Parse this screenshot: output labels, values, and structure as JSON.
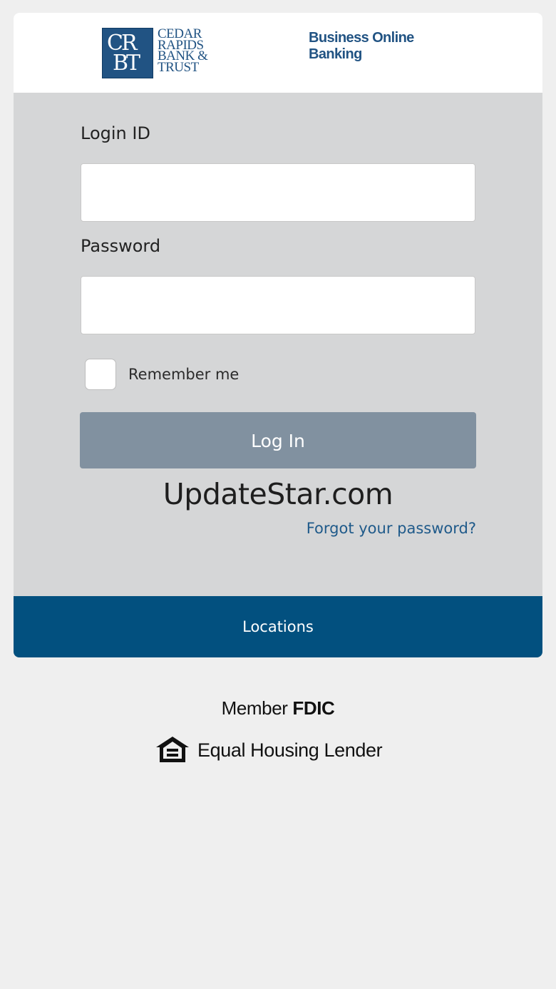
{
  "header": {
    "logo_monogram_top": "CR",
    "logo_monogram_bottom": "BT",
    "logo_lines": [
      "CEDAR",
      "RAPIDS",
      "BANK &",
      "TRUST"
    ],
    "product_title": "Business Online Banking"
  },
  "form": {
    "login_id_label": "Login ID",
    "login_id_value": "",
    "password_label": "Password",
    "password_value": "",
    "remember_label": "Remember me",
    "remember_checked": false,
    "login_button": "Log In",
    "forgot_link": "Forgot your password?"
  },
  "watermark": "UpdateStar.com",
  "footer": {
    "locations_label": "Locations",
    "member_label": "Member",
    "fdic_label": "FDIC",
    "equal_housing_label": "Equal Housing Lender"
  },
  "colors": {
    "brand_blue": "#02507f",
    "logo_blue": "#215383",
    "button_gray": "#8191a0",
    "panel_gray": "#d5d6d7",
    "page_bg": "#efefef"
  },
  "icons": [
    "equal-housing-icon"
  ]
}
